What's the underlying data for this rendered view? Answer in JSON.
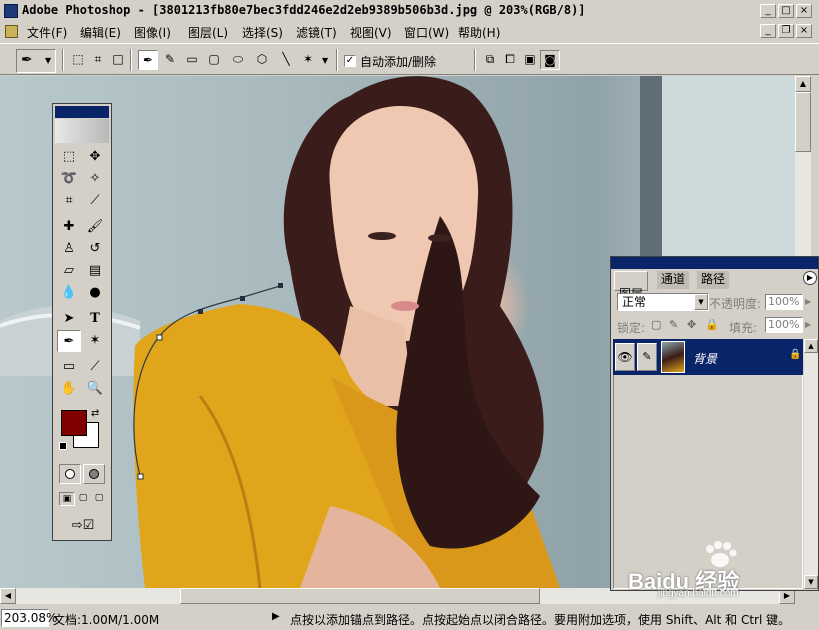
{
  "window": {
    "title": "Adobe Photoshop - [3801213fb80e7bec3fdd246e2d2eb9389b506b3d.jpg @ 203%(RGB/8)]"
  },
  "menubar": {
    "items": [
      "文件(F)",
      "编辑(E)",
      "图像(I)",
      "图层(L)",
      "选择(S)",
      "滤镜(T)",
      "视图(V)",
      "窗口(W)",
      "帮助(H)"
    ]
  },
  "options": {
    "auto_add_delete_label": "自动添加/删除",
    "auto_add_delete_checked": true
  },
  "layers_panel": {
    "tabs": [
      "图层",
      "通道",
      "路径"
    ],
    "blend_mode": "正常",
    "opacity_label": "不透明度:",
    "opacity_value": "100%",
    "lock_label": "锁定:",
    "fill_label": "填充:",
    "fill_value": "100%",
    "layer_name": "背景"
  },
  "toolbox": {
    "foreground_color": "#800000",
    "background_color": "#ffffff"
  },
  "statusbar": {
    "zoom": "203.08%",
    "doc_size": "文档:1.00M/1.00M",
    "hint": "点按以添加锚点到路径。点按起始点以闭合路径。要用附加选项，使用 Shift、Alt 和 Ctrl 键。"
  },
  "watermark": {
    "brand": "Baidu 经验",
    "url": "jingyan.baidu.com"
  },
  "colors": {
    "title_blue": "#0a246a",
    "dress_yellow": "#e1a51c",
    "chrome": "#d4d0c8"
  }
}
